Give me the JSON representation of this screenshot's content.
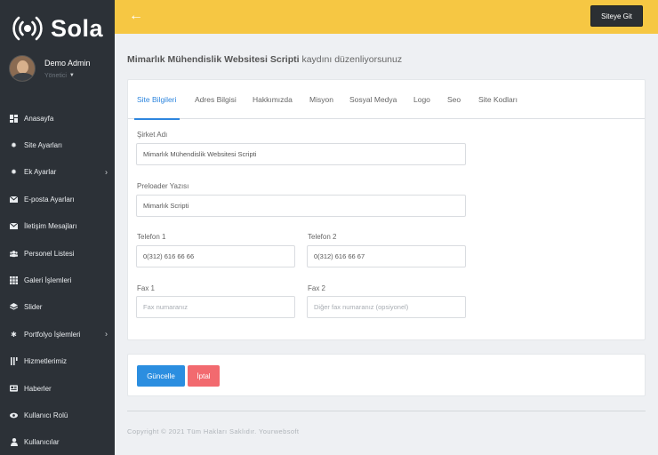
{
  "sidebar": {
    "brand": "Sola",
    "user": {
      "name": "Demo Admin",
      "role": "Yönetici"
    },
    "items": [
      {
        "label": "Anasayfa",
        "icon": "dashboard-icon"
      },
      {
        "label": "Site Ayarları",
        "icon": "gear-icon"
      },
      {
        "label": "Ek Ayarlar",
        "icon": "gear-icon",
        "has_submenu": true
      },
      {
        "label": "E-posta Ayarları",
        "icon": "envelope-icon"
      },
      {
        "label": "İletişim Mesajları",
        "icon": "envelope-icon"
      },
      {
        "label": "Personel Listesi",
        "icon": "users-icon"
      },
      {
        "label": "Galeri İşlemleri",
        "icon": "grid-icon"
      },
      {
        "label": "Slider",
        "icon": "layers-icon"
      },
      {
        "label": "Portfolyo İşlemleri",
        "icon": "star-icon",
        "has_submenu": true
      },
      {
        "label": "Hizmetlerimiz",
        "icon": "flag-icon"
      },
      {
        "label": "Haberler",
        "icon": "newspaper-icon"
      },
      {
        "label": "Kullanıcı Rolü",
        "icon": "eye-icon"
      },
      {
        "label": "Kullanıcılar",
        "icon": "user-icon"
      }
    ]
  },
  "topbar": {
    "back_icon": "arrow-left-icon",
    "site_button": "Siteye Git"
  },
  "page": {
    "title_bold": "Mimarlık Mühendislik Websitesi Scripti",
    "title_rest": " kaydını düzenliyorsunuz"
  },
  "tabs": [
    "Site Bilgileri",
    "Adres Bilgisi",
    "Hakkımızda",
    "Misyon",
    "Sosyal Medya",
    "Logo",
    "Seo",
    "Site Kodları"
  ],
  "form": {
    "company_label": "Şirket Adı",
    "company_value": "Mimarlık Mühendislik Websitesi Scripti",
    "preloader_label": "Preloader Yazısı",
    "preloader_value": "Mimarlık Scripti",
    "phone1_label": "Telefon 1",
    "phone1_value": "0(312) 616 66 66",
    "phone2_label": "Telefon 2",
    "phone2_value": "0(312) 616 66 67",
    "fax1_label": "Fax 1",
    "fax1_placeholder": "Fax numaranız",
    "fax2_label": "Fax 2",
    "fax2_placeholder": "Diğer fax numaranız (opsiyonel)"
  },
  "actions": {
    "update": "Güncelle",
    "cancel": "İptal"
  },
  "footer": "Copyright © 2021 Tüm Hakları Saklıdır. Yourwebsoft",
  "colors": {
    "sidebar_bg": "#2c3137",
    "topbar_bg": "#f6c743",
    "accent": "#2e86de",
    "update_button": "#2b8ee0",
    "cancel_button": "#f26a6f"
  }
}
